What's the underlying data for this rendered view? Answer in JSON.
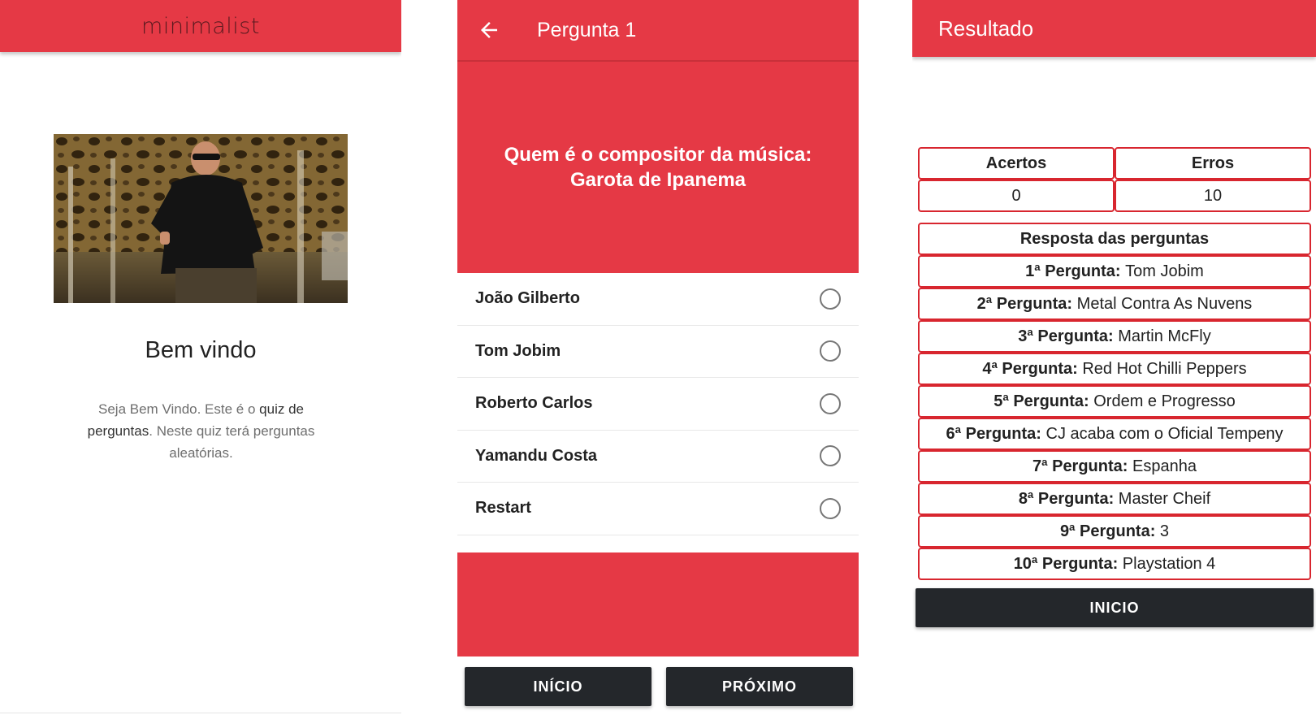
{
  "welcome": {
    "brand": "minimalist",
    "title": "Bem vindo",
    "desc_part1": "Seja Bem Vindo. Este é o ",
    "desc_part2": "quiz de perguntas",
    "desc_part3": ". Neste quiz terá perguntas aleatórias."
  },
  "question_screen": {
    "title": "Pergunta 1",
    "question_line1": "Quem é o compositor da música:",
    "question_line2": "Garota de Ipanema",
    "options": [
      "João Gilberto",
      "Tom Jobim",
      "Roberto Carlos",
      "Yamandu Costa",
      "Restart"
    ],
    "btn_inicio": "INÍCIO",
    "btn_proximo": "PRÓXIMO"
  },
  "result": {
    "title": "Resultado",
    "acertos_label": "Acertos",
    "erros_label": "Erros",
    "acertos": "0",
    "erros": "10",
    "answers_header": "Resposta das perguntas",
    "answers": [
      {
        "label": "1ª Pergunta:",
        "value": "Tom Jobim"
      },
      {
        "label": "2ª Pergunta:",
        "value": "Metal Contra As Nuvens"
      },
      {
        "label": "3ª Pergunta:",
        "value": "Martin McFly"
      },
      {
        "label": "4ª Pergunta:",
        "value": "Red Hot Chilli Peppers"
      },
      {
        "label": "5ª Pergunta:",
        "value": "Ordem e Progresso"
      },
      {
        "label": "6ª Pergunta:",
        "value": "CJ acaba com o Oficial Tempeny"
      },
      {
        "label": "7ª Pergunta:",
        "value": "Espanha"
      },
      {
        "label": "8ª Pergunta:",
        "value": "Master Cheif"
      },
      {
        "label": "9ª Pergunta:",
        "value": "3"
      },
      {
        "label": "10ª Pergunta:",
        "value": "Playstation 4"
      }
    ],
    "btn_inicio": "INICIO"
  },
  "colors": {
    "primary": "#e53945",
    "button_dark": "#24272b"
  }
}
